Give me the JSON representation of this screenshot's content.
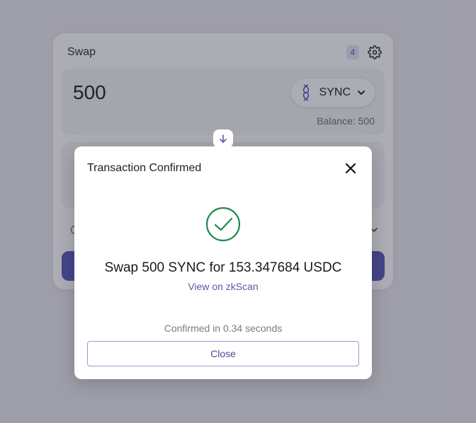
{
  "swap": {
    "title": "Swap",
    "badge": "4",
    "from": {
      "amount": "500",
      "token": "SYNC",
      "balance": "Balance: 500"
    }
  },
  "modal": {
    "title": "Transaction Confirmed",
    "message": "Swap 500 SYNC for 153.347684 USDC",
    "link_label": "View on zkScan",
    "status": "Confirmed in 0.34 seconds",
    "close_label": "Close"
  },
  "colors": {
    "accent": "#5957b8",
    "success": "#1f8a4c",
    "link": "#5a59a8"
  },
  "icons": {
    "settings": "gear-icon",
    "token": "sync-token-icon",
    "dropdown": "chevron-down-icon",
    "direction": "arrow-down-icon",
    "close": "close-icon",
    "success": "check-circle-icon"
  }
}
